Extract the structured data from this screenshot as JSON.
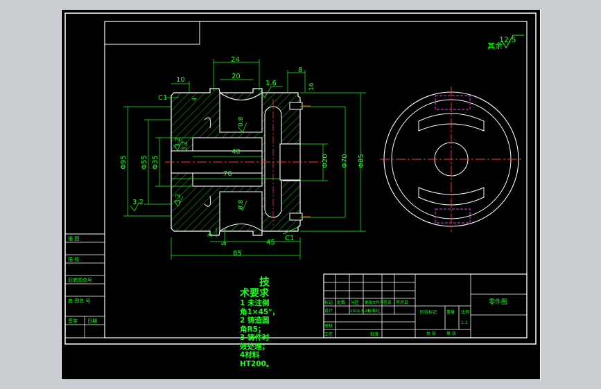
{
  "drawing": {
    "roughness_mark": "12.5",
    "roughness_label": "其余",
    "dims": {
      "d24": "24",
      "d20": "20",
      "d10": "10",
      "d8": "8",
      "d16": "16",
      "d1_6": "1.6",
      "c1_top": "C1",
      "c1_bottom": "C1",
      "d0_8_top": "0.8",
      "d0_8_bottom": "0.8",
      "d3_2_a": "3.2",
      "d3_2_b": "3.2",
      "d3_2_c": "3.2",
      "d3_2_d": "3.2",
      "d40": "40",
      "d70": "70",
      "d45": "45",
      "d85": "85",
      "d5": "5",
      "d3": "3",
      "d4": "4",
      "phi95": "Φ95",
      "phi55": "Φ55",
      "phi35": "Φ35",
      "phi20": "Φ20",
      "phi70": "Φ70",
      "phi85": "Φ85"
    },
    "left_table": [
      "描 图",
      "描 校",
      "旧底图总号",
      "底 图总 号",
      "签字",
      "日期"
    ],
    "tech_req": {
      "title1": "技",
      "title2": "术要求",
      "lines": [
        "1 未注倒",
        "角1×45°，",
        "2 铸造圆",
        "角R5；",
        "3 铸件时",
        "效处理；",
        "4材料",
        "HT200。"
      ]
    },
    "title_block": {
      "h_mark": "标记",
      "h_count": "处数",
      "h_zone": "分区",
      "h_docno": "更改文件号",
      "h_sign": "签名",
      "h_date": "年月日",
      "design": "设计",
      "date_val": "2016.3.23",
      "standard": "标准化",
      "review": "审核",
      "process": "工艺",
      "approve": "批准",
      "stage": "阶段标记",
      "weight": "重量",
      "scale": "比例",
      "scale_val": "1:1",
      "sheets_total": "共 张",
      "sheet_no": "第 张",
      "part_name": "零件图"
    }
  }
}
